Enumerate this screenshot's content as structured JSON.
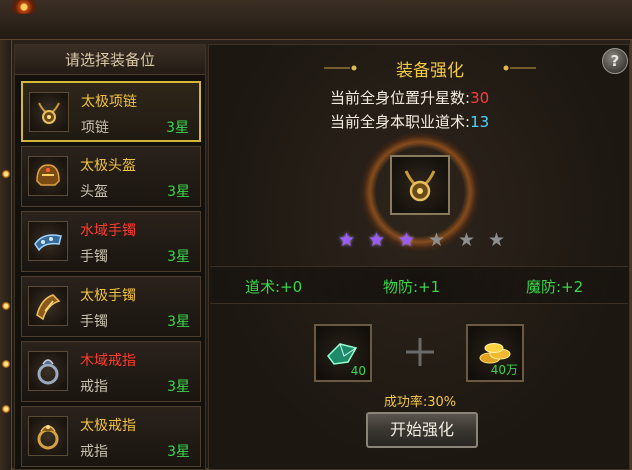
{
  "list": {
    "header": "请选择装备位",
    "items": [
      {
        "name": "太极项链",
        "type": "项链",
        "stars": "3星",
        "name_color": "gold",
        "icon": "necklace-icon"
      },
      {
        "name": "太极头盔",
        "type": "头盔",
        "stars": "3星",
        "name_color": "gold",
        "icon": "helmet-icon"
      },
      {
        "name": "水域手镯",
        "type": "手镯",
        "stars": "3星",
        "name_color": "red",
        "icon": "bracelet-icon"
      },
      {
        "name": "太极手镯",
        "type": "手镯",
        "stars": "3星",
        "name_color": "gold",
        "icon": "bracelet-icon"
      },
      {
        "name": "木域戒指",
        "type": "戒指",
        "stars": "3星",
        "name_color": "red",
        "icon": "ring-icon"
      },
      {
        "name": "太极戒指",
        "type": "戒指",
        "stars": "3星",
        "name_color": "gold",
        "icon": "ring-icon"
      }
    ],
    "selected_index": 0
  },
  "main": {
    "title": "装备强化",
    "total_star_label": "当前全身位置升星数:",
    "total_star_value": "30",
    "total_dao_label": "当前全身本职业道术:",
    "total_dao_value": "13",
    "stars_lit": 3,
    "stars_total": 6,
    "bonuses": [
      {
        "label": "道术:+0"
      },
      {
        "label": "物防:+1"
      },
      {
        "label": "魔防:+2"
      }
    ],
    "materials": [
      {
        "qty": "40",
        "icon": "jade-stone-icon"
      },
      {
        "qty": "40万",
        "icon": "gold-coins-icon"
      }
    ],
    "success_rate": "成功率:30%",
    "start_button": "开始强化",
    "help_button": "?"
  },
  "colors": {
    "gold": "#f0c040",
    "red": "#ff3b30",
    "green": "#3bd64b",
    "cyan": "#4ad4ff",
    "star_lit": "#9b5cff",
    "star_dim": "#8e8e8e"
  }
}
